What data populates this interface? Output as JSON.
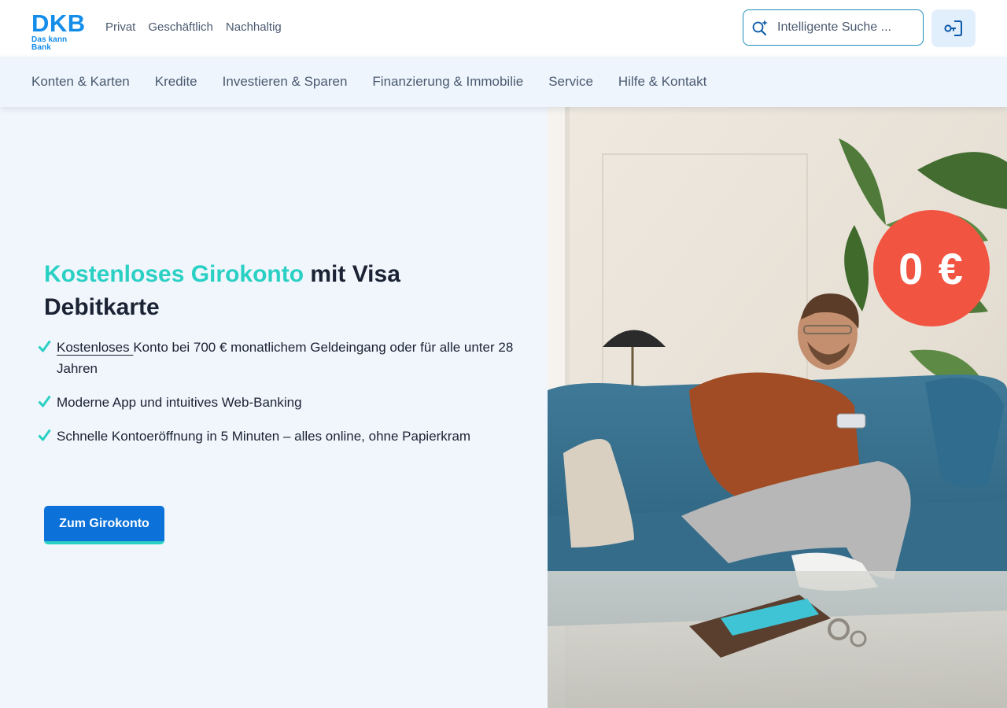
{
  "brand": {
    "logo_word": "DKB",
    "logo_tagline": "Das kann Bank",
    "color": "#148dea"
  },
  "segment_nav": [
    "Privat",
    "Geschäftlich",
    "Nachhaltig"
  ],
  "search": {
    "placeholder": "Intelligente Suche ..."
  },
  "main_nav": [
    "Konten & Karten",
    "Kredite",
    "Investieren & Sparen",
    "Finanzierung & Immobilie",
    "Service",
    "Hilfe & Kontakt"
  ],
  "hero": {
    "headline_accent": "Kostenloses Girokonto",
    "headline_rest": " mit Visa Debitkarte",
    "benefits": [
      {
        "underlined": "Kostenloses ",
        "text": "Konto bei 700 € monatlichem Geldeingang oder für alle unter 28 Jahren"
      },
      {
        "underlined": "",
        "text": "Moderne App und intuitives Web-Banking"
      },
      {
        "underlined": "",
        "text": "Schnelle Kontoeröffnung in 5 Minuten – alles online, ohne Papierkram"
      }
    ],
    "cta_label": "Zum Girokonto",
    "badge_text": "0 €"
  },
  "colors": {
    "accent": "#2ad0c3",
    "primary_button": "#0c72d9",
    "badge": "#f25442"
  }
}
